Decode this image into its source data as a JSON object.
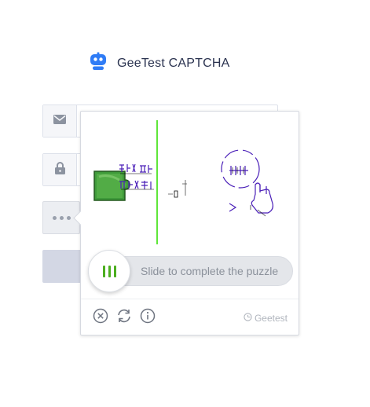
{
  "header": {
    "title": "GeeTest CAPTCHA",
    "logo_icon": "robot-icon",
    "brand_color": "#2f7cf6"
  },
  "form": {
    "email_icon": "mail-icon",
    "password_icon": "lock-icon",
    "more_icon": "ellipsis-icon"
  },
  "captcha": {
    "slider_hint": "Slide to complete the puzzle",
    "slider_handle_icon": "grip-bars-icon",
    "accent_color": "#4cae1f",
    "footer": {
      "close_icon": "close-circle-icon",
      "refresh_icon": "refresh-icon",
      "info_icon": "info-icon",
      "provider_label": "Geetest"
    }
  }
}
